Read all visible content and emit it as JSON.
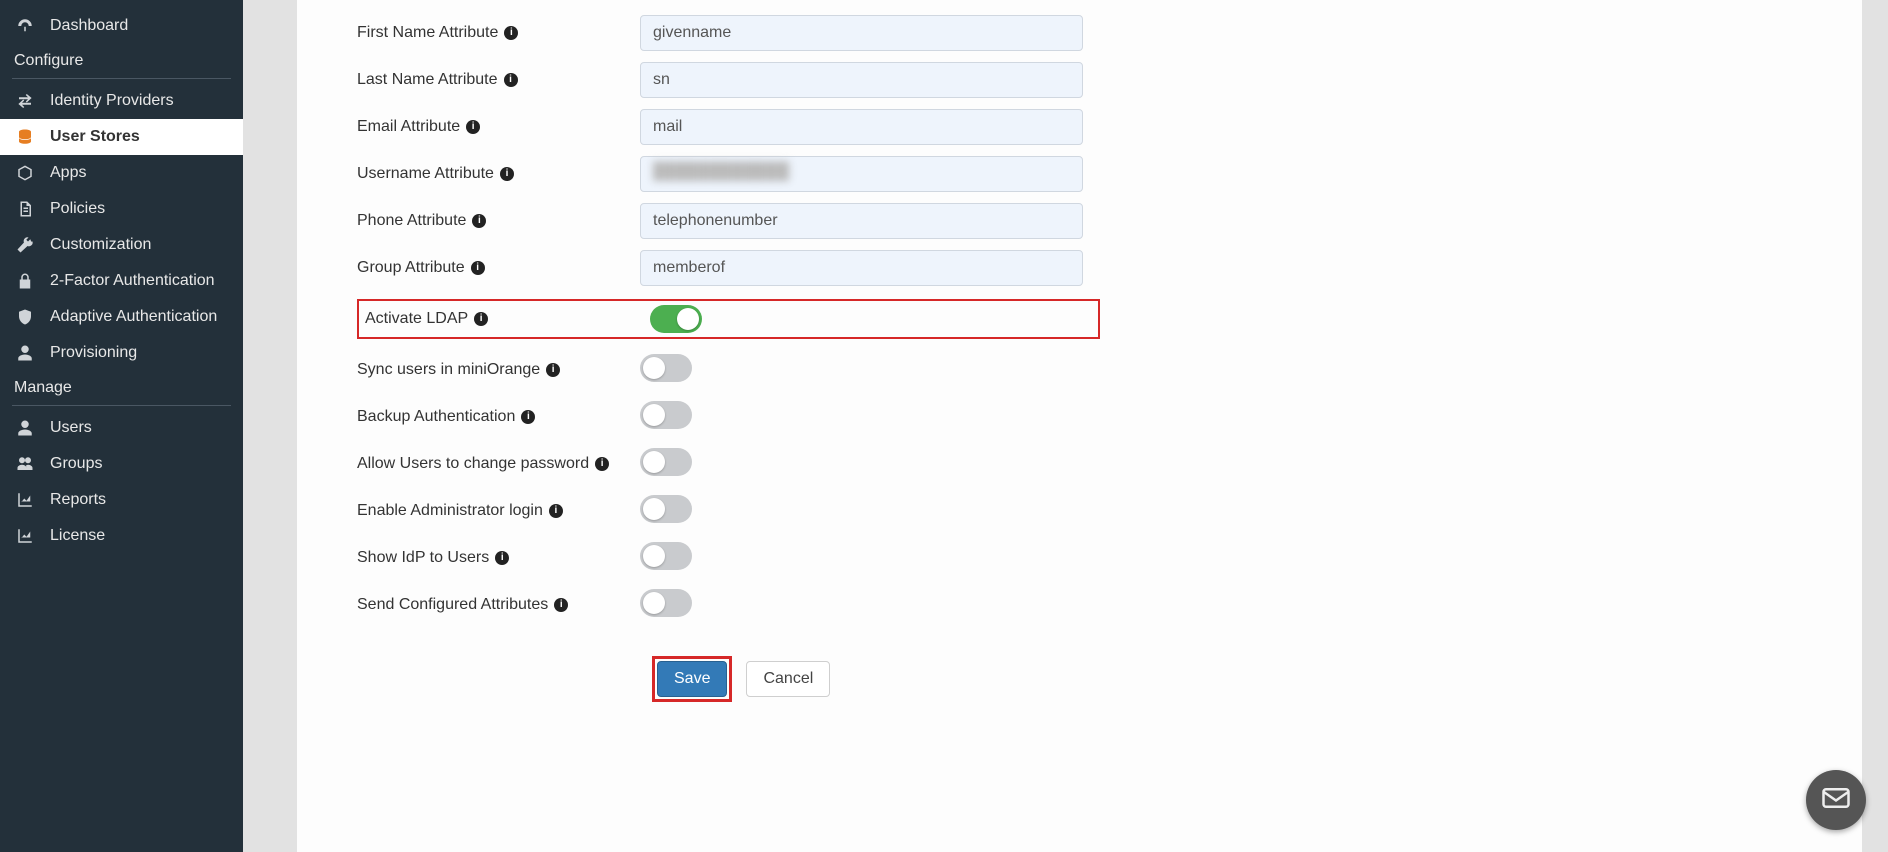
{
  "sidebar": {
    "dashboard": "Dashboard",
    "section_configure": "Configure",
    "identity_providers": "Identity Providers",
    "user_stores": "User Stores",
    "apps": "Apps",
    "policies": "Policies",
    "customization": "Customization",
    "two_factor": "2-Factor Authentication",
    "adaptive_auth": "Adaptive Authentication",
    "provisioning": "Provisioning",
    "section_manage": "Manage",
    "users": "Users",
    "groups": "Groups",
    "reports": "Reports",
    "license": "License"
  },
  "form": {
    "first_name_attr": {
      "label": "First Name Attribute",
      "value": "givenname"
    },
    "last_name_attr": {
      "label": "Last Name Attribute",
      "value": "sn"
    },
    "email_attr": {
      "label": "Email Attribute",
      "value": "mail"
    },
    "username_attr": {
      "label": "Username Attribute",
      "value": ""
    },
    "phone_attr": {
      "label": "Phone Attribute",
      "value": "telephonenumber"
    },
    "group_attr": {
      "label": "Group Attribute",
      "value": "memberof"
    },
    "activate_ldap": {
      "label": "Activate LDAP",
      "on": true
    },
    "sync_users": {
      "label": "Sync users in miniOrange",
      "on": false
    },
    "backup_auth": {
      "label": "Backup Authentication",
      "on": false
    },
    "allow_change_pw": {
      "label": "Allow Users to change password",
      "on": false
    },
    "enable_admin_login": {
      "label": "Enable Administrator login",
      "on": false
    },
    "show_idp": {
      "label": "Show IdP to Users",
      "on": false
    },
    "send_configured_attrs": {
      "label": "Send Configured Attributes",
      "on": false
    }
  },
  "buttons": {
    "save": "Save",
    "cancel": "Cancel"
  },
  "info_glyph": "i"
}
